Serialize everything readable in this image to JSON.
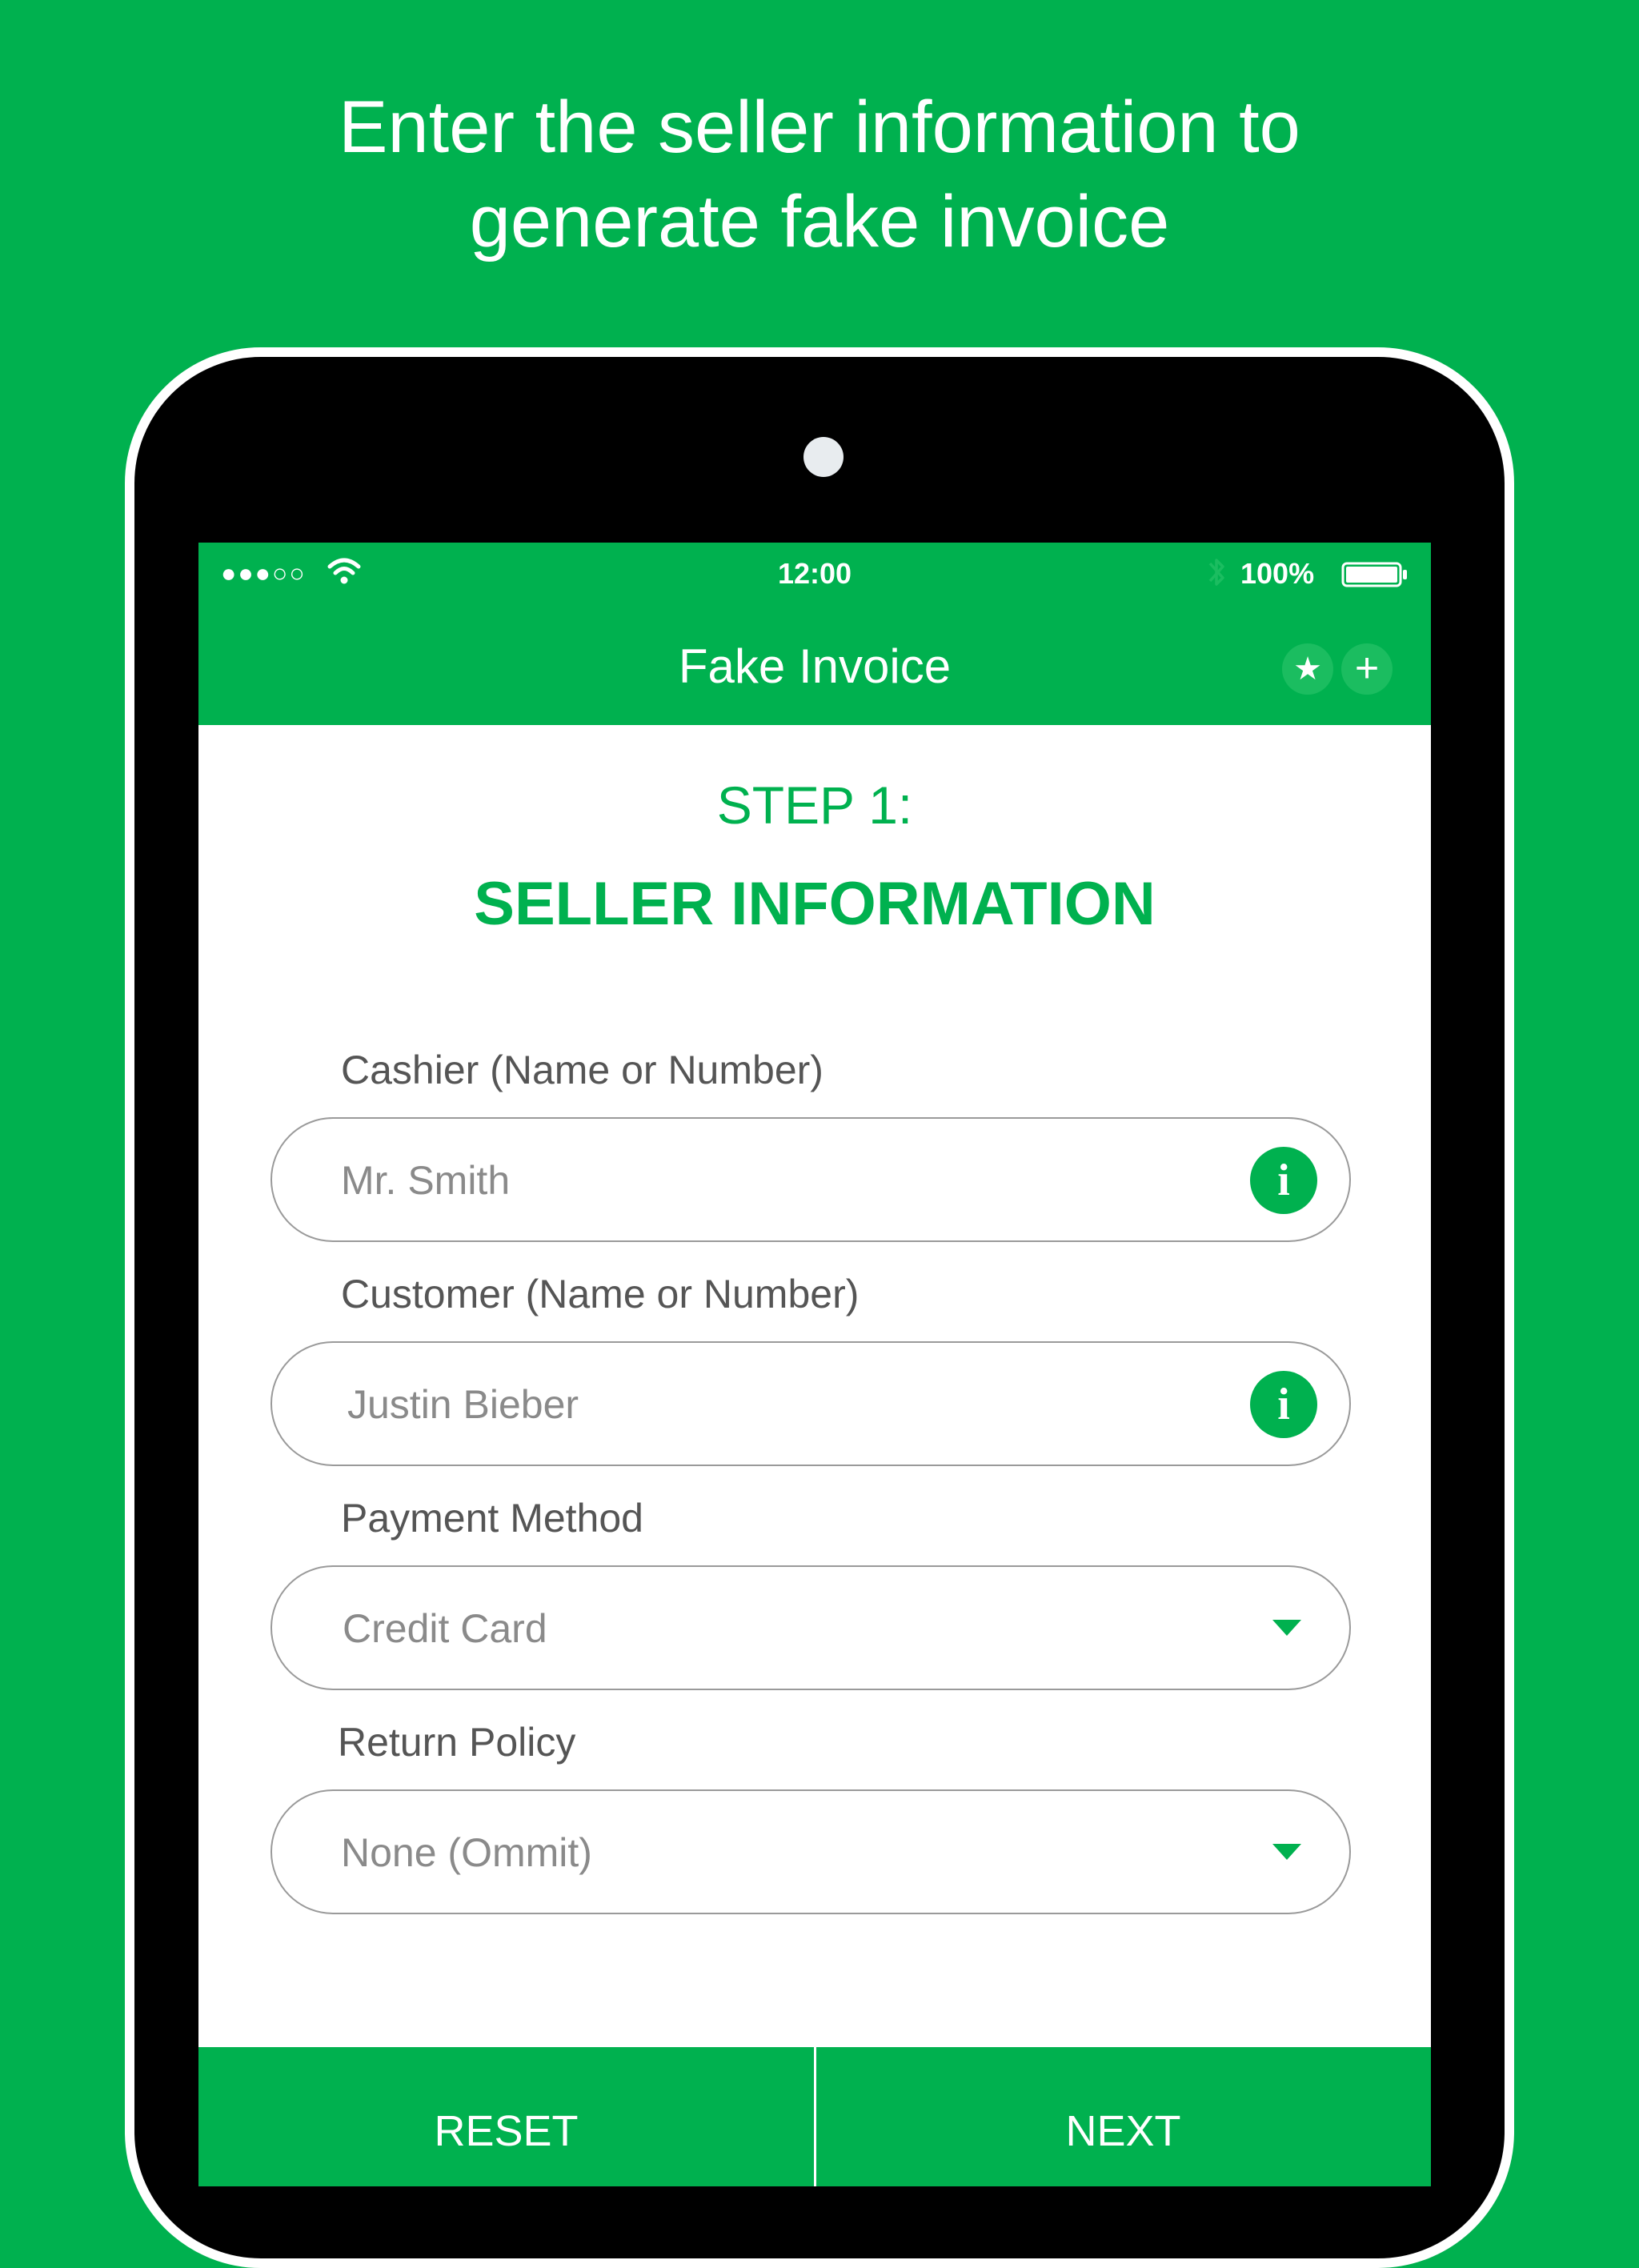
{
  "headline": {
    "line1": "Enter the seller information to",
    "line2": "generate fake invoice"
  },
  "status_bar": {
    "signal": "●●●○○",
    "time": "12:00",
    "battery": "100%"
  },
  "nav": {
    "title": "Fake Invoice",
    "favorite_glyph": "★",
    "add_glyph": "+"
  },
  "step": {
    "label": "STEP 1:",
    "title": "SELLER INFORMATION"
  },
  "fields": {
    "cashier": {
      "label": "Cashier (Name or Number)",
      "value": "Mr. Smith"
    },
    "customer": {
      "label": "Customer (Name or Number)",
      "value": "Justin Bieber"
    },
    "payment": {
      "label": "Payment Method",
      "value": "Credit Card"
    },
    "return_policy": {
      "label": "Return Policy",
      "value": "None (Ommit)"
    }
  },
  "info_glyph": "i",
  "buttons": {
    "reset": "RESET",
    "next": "NEXT"
  },
  "colors": {
    "brand_green": "#00b14f",
    "text_gray": "#555555"
  }
}
